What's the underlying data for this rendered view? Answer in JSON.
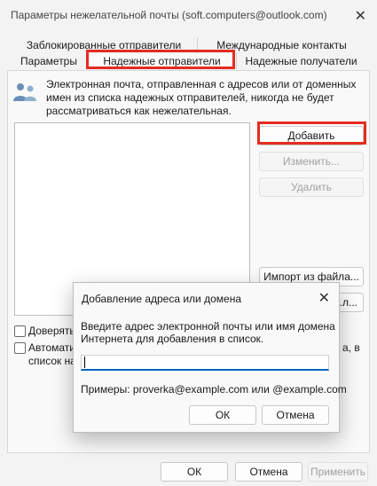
{
  "window": {
    "title": "Параметры нежелательной почты (soft.computers@outlook.com)",
    "close_glyph": "✕"
  },
  "tabs": {
    "row1": [
      "Заблокированные отправители",
      "Международные контакты"
    ],
    "row2": [
      "Параметры",
      "Надежные отправители",
      "Надежные получатели"
    ],
    "selected": "Надежные отправители"
  },
  "info_text": "Электронная почта, отправленная с адресов или от доменных имен из списка надежных отправителей, никогда не будет рассматриваться как нежелательная.",
  "buttons": {
    "add": "Добавить",
    "edit": "Изменить...",
    "remove": "Удалить",
    "import": "Импорт из файла...",
    "export_partial": "...л..."
  },
  "checkboxes": [
    {
      "label_partial": "Доверять",
      "checked": false
    },
    {
      "label_partial": "Автомати",
      "label_right": "а, в",
      "label_line2": "список на",
      "checked": false
    }
  ],
  "footer": {
    "ok": "ОК",
    "cancel": "Отмена",
    "apply": "Применить"
  },
  "dialog": {
    "title": "Добавление адреса или домена",
    "close_glyph": "✕",
    "prompt": "Введите адрес электронной почты или имя домена Интернета для добавления в список.",
    "input_value": "",
    "examples": "Примеры: proverka@example.com или @example.com",
    "ok": "ОК",
    "cancel": "Отмена"
  },
  "colors": {
    "highlight": "#e32d1f",
    "focus_underline": "#0067c0"
  },
  "icons": [
    "people-icon",
    "close-icon"
  ]
}
